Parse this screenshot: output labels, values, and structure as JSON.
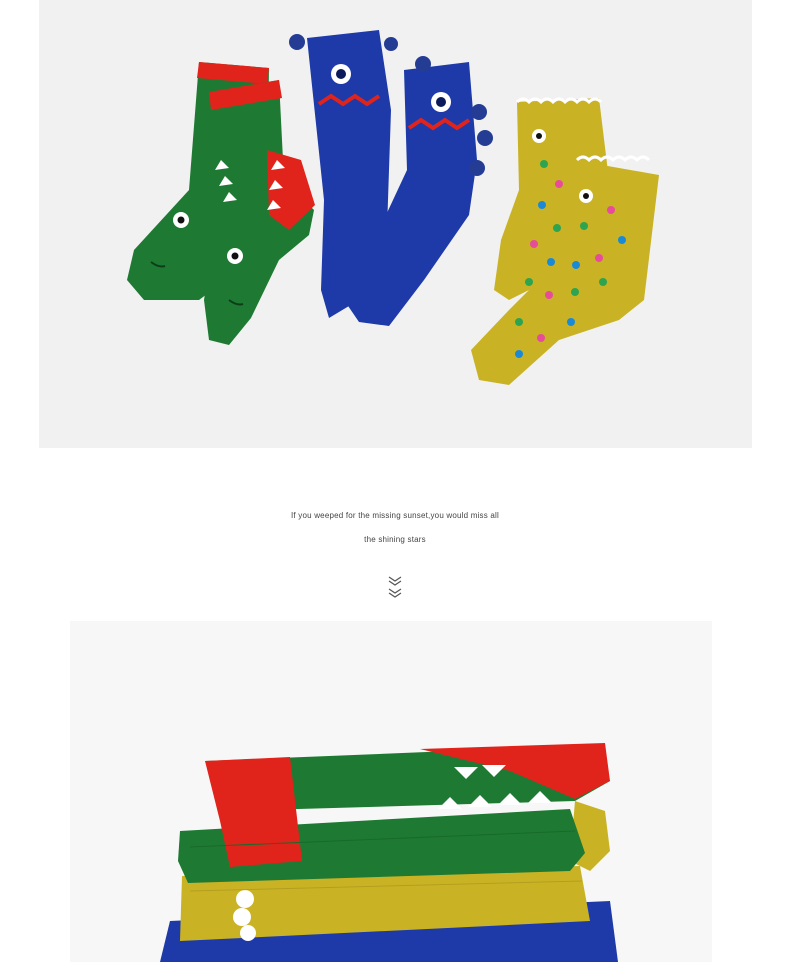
{
  "tagline": {
    "line1": "If you weeped for the missing sunset,you would miss all",
    "line2": "the shining stars"
  },
  "colors": {
    "green": "#1e7a32",
    "red": "#e0241c",
    "blue": "#1e3aa8",
    "yellow": "#c9b325",
    "background": "#f1f1f1"
  },
  "icons": {
    "scroll": "double-chevron-down-icon"
  }
}
